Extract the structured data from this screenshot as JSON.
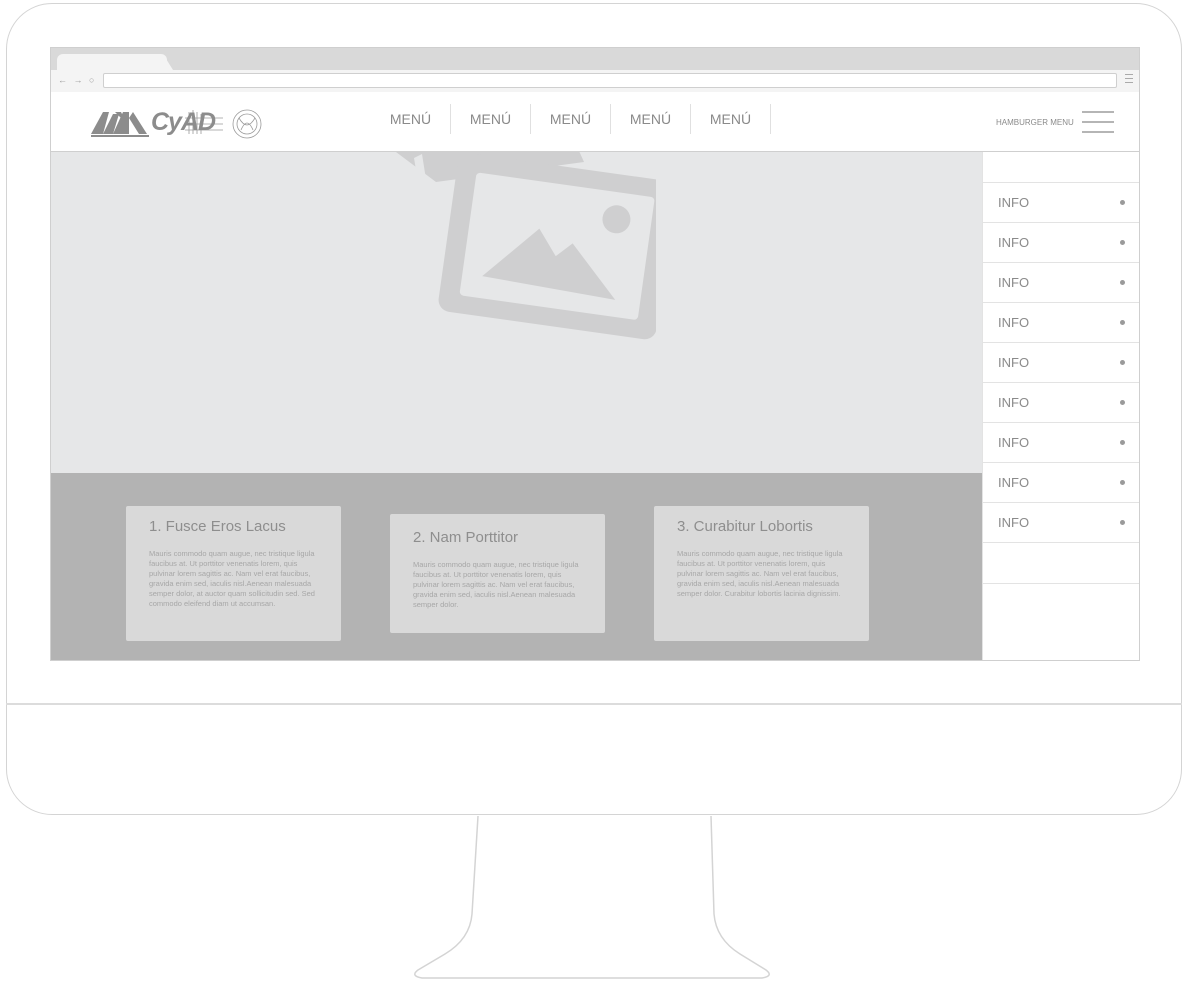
{
  "browser": {
    "nav_glyphs": "← → ○"
  },
  "site": {
    "logo_text": "CyAD",
    "nav_items": [
      "MENÚ",
      "MENÚ",
      "MENÚ",
      "MENÚ",
      "MENÚ"
    ],
    "hamburger_label": "HAMBURGER MENU"
  },
  "cards": [
    {
      "title": "1. Fusce Eros Lacus",
      "body": "Mauris commodo quam augue, nec tristique ligula faucibus at. Ut porttitor venenatis lorem, quis pulvinar lorem sagittis ac. Nam vel erat faucibus, gravida enim sed, iaculis nisl.Aenean malesuada semper dolor, at auctor quam sollicitudin sed. Sed commodo eleifend diam ut accumsan."
    },
    {
      "title": "2. Nam Porttitor",
      "body": "Mauris commodo quam augue, nec tristique ligula faucibus at. Ut porttitor venenatis lorem, quis pulvinar lorem sagittis ac. Nam vel erat faucibus, gravida enim sed, iaculis nisl.Aenean malesuada semper dolor."
    },
    {
      "title": "3. Curabitur Lobortis",
      "body": "Mauris commodo quam augue, nec tristique ligula faucibus at. Ut porttitor venenatis lorem, quis pulvinar lorem sagittis ac. Nam vel erat faucibus, gravida enim sed, iaculis nisl.Aenean malesuada semper dolor. Curabitur lobortis lacinia dignissim."
    }
  ],
  "sidebar": {
    "items": [
      {
        "label": "INFO"
      },
      {
        "label": "INFO"
      },
      {
        "label": "INFO"
      },
      {
        "label": "INFO"
      },
      {
        "label": "INFO"
      },
      {
        "label": "INFO"
      },
      {
        "label": "INFO"
      },
      {
        "label": "INFO"
      },
      {
        "label": "INFO"
      }
    ]
  },
  "icons": {
    "hero": "image-placeholder-icon",
    "menu": "hamburger-icon"
  },
  "colors": {
    "hero_bg": "#e6e7e8",
    "band_bg": "#b3b3b3",
    "card_bg": "#d9d9d9"
  }
}
